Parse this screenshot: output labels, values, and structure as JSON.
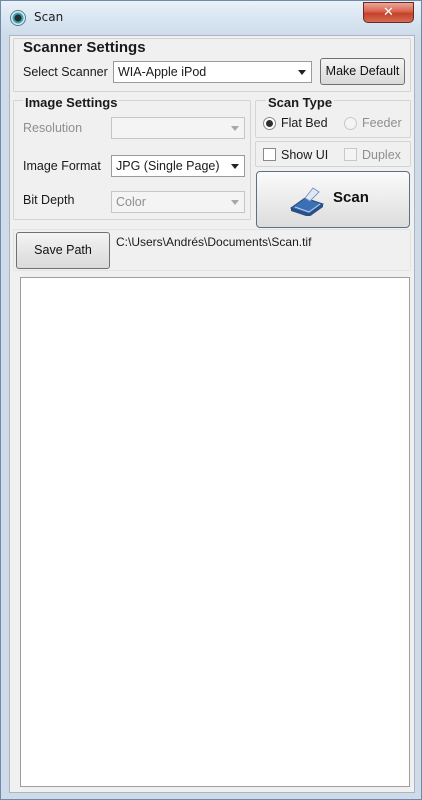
{
  "window": {
    "title": "Scan",
    "close_label": "✕"
  },
  "scanner_settings": {
    "heading": "Scanner Settings",
    "select_label": "Select Scanner",
    "selected_scanner": "WIA-Apple iPod",
    "make_default_label": "Make Default"
  },
  "image_settings": {
    "heading": "Image Settings",
    "resolution_label": "Resolution",
    "resolution_value": "",
    "format_label": "Image Format",
    "format_value": "JPG (Single Page)",
    "bit_depth_label": "Bit Depth",
    "bit_depth_value": "Color"
  },
  "scan_type": {
    "heading": "Scan Type",
    "flatbed_label": "Flat Bed",
    "flatbed_checked": true,
    "feeder_label": "Feeder",
    "feeder_checked": false,
    "show_ui_label": "Show UI",
    "show_ui_checked": false,
    "duplex_label": "Duplex",
    "duplex_checked": false
  },
  "scan_button_label": "Scan",
  "save_path": {
    "button_label": "Save Path",
    "path_value": "C:\\Users\\Andrés\\Documents\\Scan.tif"
  },
  "icons": {
    "app": "scanner-app-icon",
    "scan": "scanner-icon",
    "close": "close-icon"
  },
  "colors": {
    "titlebar": "#d7e4f1",
    "close": "#c5412b",
    "panel": "#f0f0f0"
  }
}
